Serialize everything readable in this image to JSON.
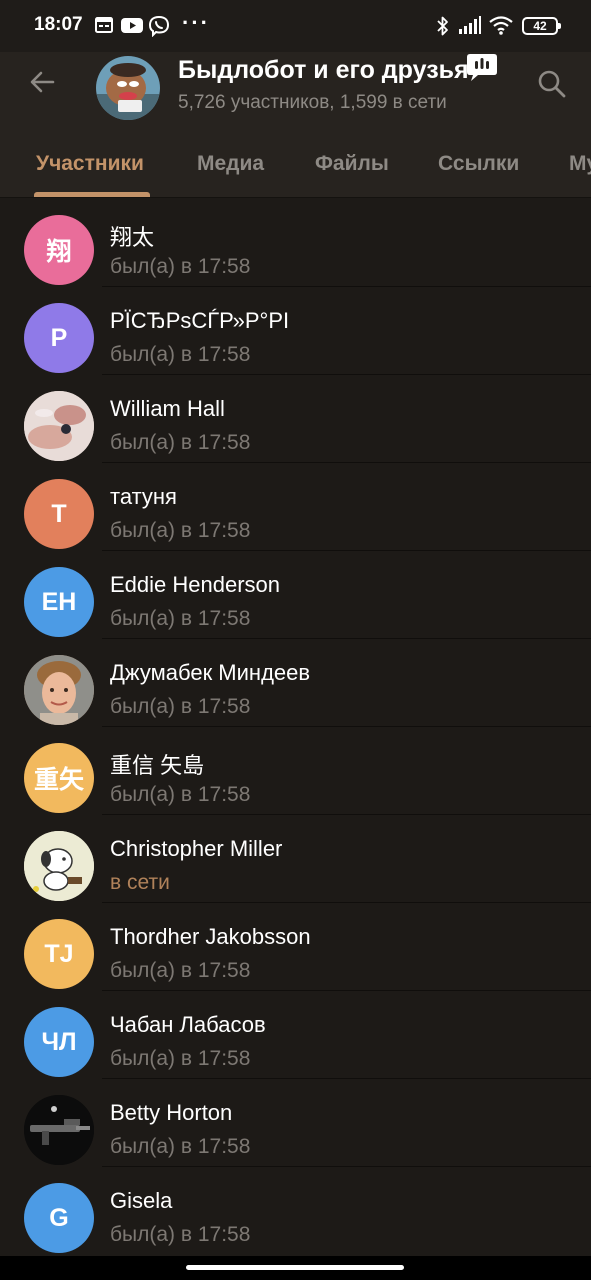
{
  "status_bar": {
    "time": "18:07",
    "battery": "42",
    "icons": [
      "calendar-icon",
      "youtube-icon",
      "viber-icon",
      "more-dots-icon",
      "bluetooth-icon",
      "signal-icon",
      "wifi-icon",
      "battery-icon"
    ]
  },
  "header": {
    "title": "Быдлобот и его друзья",
    "subtitle": "5,726 участников, 1,599 в сети"
  },
  "tabs": [
    {
      "label": "Участники",
      "active": true
    },
    {
      "label": "Медиа",
      "active": false
    },
    {
      "label": "Файлы",
      "active": false
    },
    {
      "label": "Ссылки",
      "active": false
    },
    {
      "label": "Му",
      "active": false
    }
  ],
  "members": [
    {
      "name": "翔太",
      "status": "был(а) в 17:58",
      "initials": "翔",
      "color": "#e96d9a",
      "photo": false
    },
    {
      "name": "РЇСЂРѕСЃР»Р°РІ",
      "status": "был(а) в 17:58",
      "initials": "P",
      "color": "#8f7ae8",
      "photo": false
    },
    {
      "name": "William Hall",
      "status": "был(а) в 17:58",
      "initials": "",
      "color": "#d9c7c2",
      "photo": true
    },
    {
      "name": "татуня",
      "status": "был(а) в 17:58",
      "initials": "T",
      "color": "#e2805c",
      "photo": false
    },
    {
      "name": "Eddie Henderson",
      "status": "был(а) в 17:58",
      "initials": "EH",
      "color": "#4c9be5",
      "photo": false
    },
    {
      "name": "Джумабек Миндеев",
      "status": "был(а) в 17:58",
      "initials": "",
      "color": "#b88c70",
      "photo": true
    },
    {
      "name": "重信 矢島",
      "status": "был(а) в 17:58",
      "initials": "重矢",
      "color": "#f2b95e",
      "photo": false
    },
    {
      "name": "Christopher Miller",
      "status": "в сети",
      "initials": "",
      "color": "#e8e6cf",
      "photo": true,
      "online": true
    },
    {
      "name": "Thordher Jakobsson",
      "status": "был(а) в 17:58",
      "initials": "TJ",
      "color": "#f2b95e",
      "photo": false
    },
    {
      "name": "Чабан Лабасов",
      "status": "был(а) в 17:58",
      "initials": "ЧЛ",
      "color": "#4c9be5",
      "photo": false
    },
    {
      "name": "Betty Horton",
      "status": "был(а) в 17:58",
      "initials": "",
      "color": "#0c0c0c",
      "photo": true
    },
    {
      "name": "Gisela",
      "status": "был(а) в 17:58",
      "initials": "G",
      "color": "#4c9be5",
      "photo": false
    }
  ],
  "colors": {
    "accent": "#c39369",
    "online": "#b0825a",
    "background": "#1d1a17",
    "header": "#27231f"
  }
}
